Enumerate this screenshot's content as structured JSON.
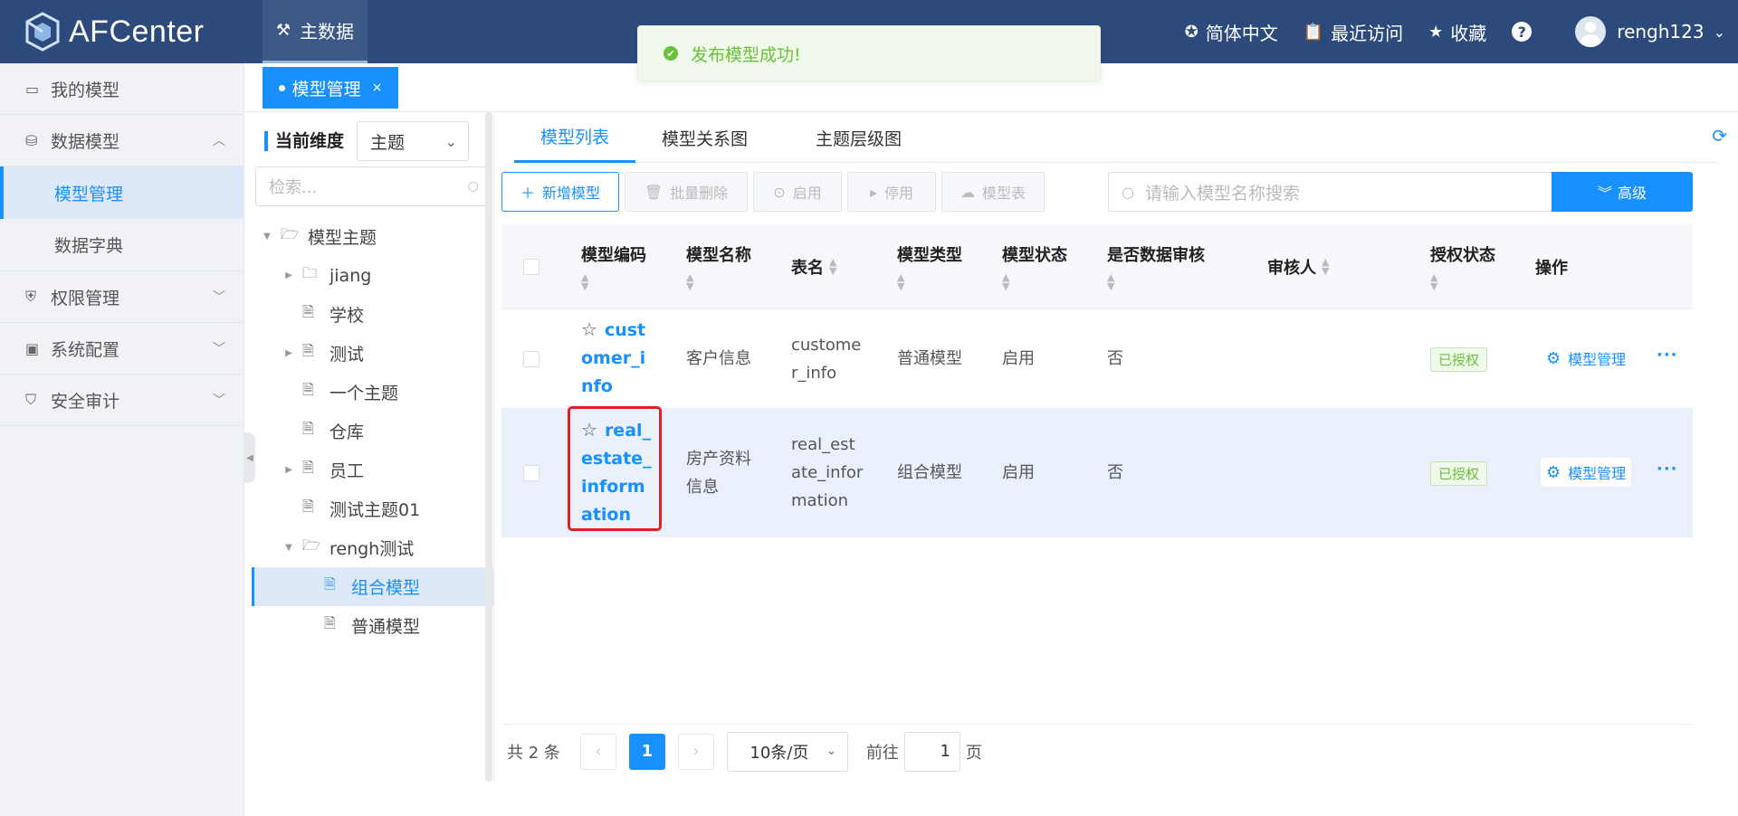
{
  "header": {
    "app_name": "AFCenter",
    "nav_label": "主数据",
    "language": "简体中文",
    "recent": "最近访问",
    "favorites": "收藏",
    "help": "?",
    "username": "rengh123"
  },
  "toast": {
    "message": "发布模型成功!"
  },
  "sidebar": {
    "items": [
      {
        "label": "我的模型",
        "icon": "wallet-icon"
      },
      {
        "label": "数据模型",
        "icon": "database-icon"
      },
      {
        "label": "模型管理",
        "sub": true,
        "active": true
      },
      {
        "label": "数据字典",
        "sub": true
      },
      {
        "label": "权限管理",
        "icon": "shield-icon"
      },
      {
        "label": "系统配置",
        "icon": "chip-icon"
      },
      {
        "label": "安全审计",
        "icon": "shield-check-icon"
      }
    ]
  },
  "page_tab": {
    "label": "模型管理",
    "close": "×"
  },
  "tree": {
    "dimension_label": "当前维度",
    "dimension_value": "主题",
    "search_placeholder": "检索...",
    "nodes": [
      {
        "label": "模型主题"
      },
      {
        "label": "jiang"
      },
      {
        "label": "学校"
      },
      {
        "label": "测试"
      },
      {
        "label": "一个主题"
      },
      {
        "label": "仓库"
      },
      {
        "label": "员工"
      },
      {
        "label": "测试主题01"
      },
      {
        "label": "rengh测试"
      },
      {
        "label": "组合模型"
      },
      {
        "label": "普通模型"
      }
    ]
  },
  "main": {
    "tabs": [
      "模型列表",
      "模型关系图",
      "主题层级图"
    ],
    "toolbar": {
      "add": "新增模型",
      "batch_delete": "批量删除",
      "enable": "启用",
      "disable": "停用",
      "model_table": "模型表"
    },
    "search_placeholder": "请输入模型名称搜索",
    "advanced": "高级",
    "columns": {
      "code": "模型编码",
      "name": "模型名称",
      "table": "表名",
      "type": "模型类型",
      "status": "模型状态",
      "audit": "是否数据审核",
      "auditor": "审核人",
      "auth": "授权状态",
      "ops": "操作"
    },
    "rows": [
      {
        "code": "customer_info",
        "name": "客户信息",
        "table": "customer_info",
        "type": "普通模型",
        "status": "启用",
        "audit": "否",
        "auditor": "",
        "auth": "已授权",
        "op": "模型管理"
      },
      {
        "code": "real_estate_information",
        "name": "房产资料信息",
        "table": "real_estate_information",
        "type": "组合模型",
        "status": "启用",
        "audit": "否",
        "auditor": "",
        "auth": "已授权",
        "op": "模型管理"
      }
    ],
    "pager": {
      "total": "共 2 条",
      "current": "1",
      "page_size": "10条/页",
      "goto_label": "前往",
      "goto_value": "1",
      "page_unit": "页"
    }
  },
  "colors": {
    "header_bg": "#2d4a7c",
    "accent": "#1890ff",
    "success": "#67c23a",
    "highlight_box": "#e02020"
  }
}
